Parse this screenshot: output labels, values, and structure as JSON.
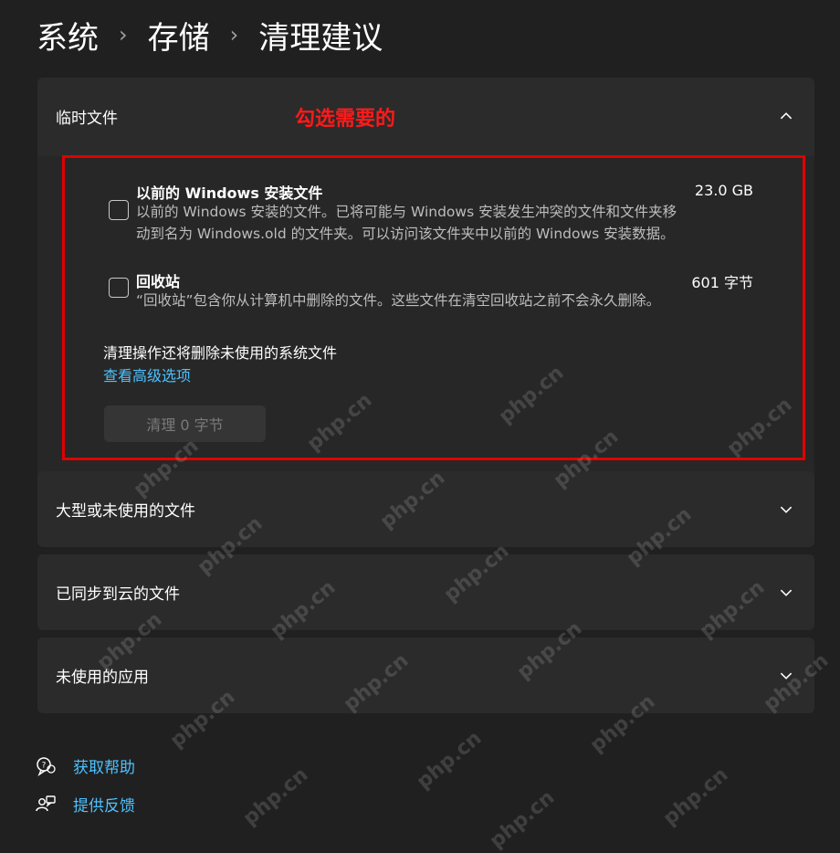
{
  "breadcrumb": {
    "items": [
      "系统",
      "存储",
      "清理建议"
    ],
    "separator": "›"
  },
  "annotation": "勾选需要的",
  "sections": {
    "temp": {
      "title": "临时文件",
      "options": [
        {
          "title": "以前的 Windows 安装文件",
          "size": "23.0 GB",
          "desc_line1": "以前的 Windows 安装的文件。已将可能与 Windows 安装发生冲突的文件和文件夹移",
          "desc_line2": "动到名为 Windows.old 的文件夹。可以访问该文件夹中以前的 Windows 安装数据。",
          "checked": false
        },
        {
          "title": "回收站",
          "size": "601 字节",
          "desc_line1": "“回收站”包含你从计算机中删除的文件。这些文件在清空回收站之前不会永久删除。",
          "checked": false
        }
      ],
      "note": "清理操作还将删除未使用的系统文件",
      "advanced_link": "查看高级选项",
      "clean_button": "清理 0 字节"
    },
    "large": {
      "title": "大型或未使用的文件"
    },
    "cloud": {
      "title": "已同步到云的文件"
    },
    "apps": {
      "title": "未使用的应用"
    }
  },
  "footer": {
    "help": "获取帮助",
    "feedback": "提供反馈"
  },
  "watermark_text": "php.cn",
  "colors": {
    "background": "#202020",
    "card": "#2b2b2b",
    "link": "#4cc2ff",
    "annotation_red": "#e00000"
  }
}
